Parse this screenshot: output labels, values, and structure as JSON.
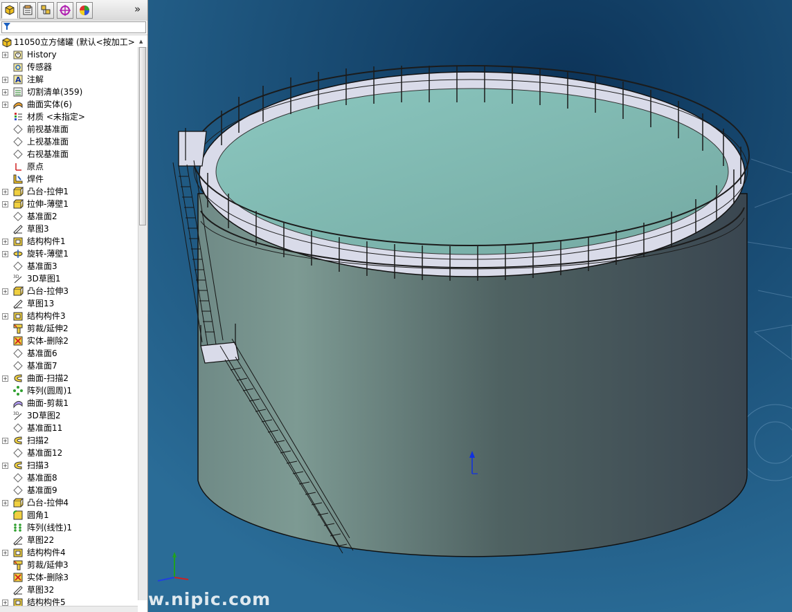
{
  "feature_manager": {
    "tabs": [
      {
        "name": "featuremanager-tab-icon"
      },
      {
        "name": "propertymanager-tab-icon"
      },
      {
        "name": "configurationmanager-tab-icon"
      },
      {
        "name": "dimxpert-tab-icon"
      },
      {
        "name": "displaymanager-tab-icon"
      }
    ],
    "more_label": "»",
    "filter_icon": "filter-icon",
    "root_label": "11050立方储罐 (默认<按加工>",
    "items": [
      {
        "label": "History",
        "icon": "history-icon",
        "expand": true
      },
      {
        "label": "传感器",
        "icon": "sensor-icon",
        "expand": false
      },
      {
        "label": "注解",
        "icon": "annotation-icon",
        "expand": true
      },
      {
        "label": "切割清单(359)",
        "icon": "cutlist-icon",
        "expand": true
      },
      {
        "label": "曲面实体(6)",
        "icon": "surface-body-icon",
        "expand": true
      },
      {
        "label": "材质 <未指定>",
        "icon": "material-icon",
        "expand": false
      },
      {
        "label": "前视基准面",
        "icon": "plane-icon",
        "expand": false
      },
      {
        "label": "上视基准面",
        "icon": "plane-icon",
        "expand": false
      },
      {
        "label": "右视基准面",
        "icon": "plane-icon",
        "expand": false
      },
      {
        "label": "原点",
        "icon": "origin-icon",
        "expand": false
      },
      {
        "label": "焊件",
        "icon": "weldment-icon",
        "expand": false
      },
      {
        "label": "凸台-拉伸1",
        "icon": "boss-extrude-icon",
        "expand": true
      },
      {
        "label": "拉伸-薄壁1",
        "icon": "boss-extrude-icon",
        "expand": true
      },
      {
        "label": "基准面2",
        "icon": "plane-icon",
        "expand": false
      },
      {
        "label": "草图3",
        "icon": "sketch-icon",
        "expand": false
      },
      {
        "label": "结构构件1",
        "icon": "structural-member-icon",
        "expand": true
      },
      {
        "label": "旋转-薄壁1",
        "icon": "revolve-icon",
        "expand": true
      },
      {
        "label": "基准面3",
        "icon": "plane-icon",
        "expand": false
      },
      {
        "label": "3D草图1",
        "icon": "sketch3d-icon",
        "expand": false
      },
      {
        "label": "凸台-拉伸3",
        "icon": "boss-extrude-icon",
        "expand": true
      },
      {
        "label": "草图13",
        "icon": "sketch-icon",
        "expand": false
      },
      {
        "label": "结构构件3",
        "icon": "structural-member-icon",
        "expand": true
      },
      {
        "label": "剪裁/延伸2",
        "icon": "trim-extend-icon",
        "expand": false
      },
      {
        "label": "实体-删除2",
        "icon": "delete-body-icon",
        "expand": false
      },
      {
        "label": "基准面6",
        "icon": "plane-icon",
        "expand": false
      },
      {
        "label": "基准面7",
        "icon": "plane-icon",
        "expand": false
      },
      {
        "label": "曲面-扫描2",
        "icon": "sweep-icon",
        "expand": true
      },
      {
        "label": "阵列(圆周)1",
        "icon": "circular-pattern-icon",
        "expand": false
      },
      {
        "label": "曲面-剪裁1",
        "icon": "surface-trim-icon",
        "expand": false
      },
      {
        "label": "3D草图2",
        "icon": "sketch3d-icon",
        "expand": false
      },
      {
        "label": "基准面11",
        "icon": "plane-icon",
        "expand": false
      },
      {
        "label": "扫描2",
        "icon": "sweep-icon",
        "expand": true
      },
      {
        "label": "基准面12",
        "icon": "plane-icon",
        "expand": false
      },
      {
        "label": "扫描3",
        "icon": "sweep-icon",
        "expand": true
      },
      {
        "label": "基准面8",
        "icon": "plane-icon",
        "expand": false
      },
      {
        "label": "基准面9",
        "icon": "plane-icon",
        "expand": false
      },
      {
        "label": "凸台-拉伸4",
        "icon": "boss-extrude-icon",
        "expand": true
      },
      {
        "label": "圆角1",
        "icon": "fillet-icon",
        "expand": false
      },
      {
        "label": "阵列(线性)1",
        "icon": "linear-pattern-icon",
        "expand": false
      },
      {
        "label": "草图22",
        "icon": "sketch-icon",
        "expand": false
      },
      {
        "label": "结构构件4",
        "icon": "structural-member-icon",
        "expand": true
      },
      {
        "label": "剪裁/延伸3",
        "icon": "trim-extend-icon",
        "expand": false
      },
      {
        "label": "实体-删除3",
        "icon": "delete-body-icon",
        "expand": false
      },
      {
        "label": "草图32",
        "icon": "sketch-icon",
        "expand": false
      },
      {
        "label": "结构构件5",
        "icon": "structural-member-icon",
        "expand": true
      }
    ]
  },
  "viewport": {
    "background_top": "#0f3d66",
    "background_bottom": "#2b6a94",
    "model_name": "11050立方储罐",
    "tank_wall_light": "#7f9d96",
    "tank_wall_dark": "#3d4a52",
    "tank_roof": "#86c1b9",
    "walkway": "#d9dbe9",
    "rail": "#1b1b1b",
    "triad_icon": "triad-icon",
    "origin_icon": "origin-arrow-icon"
  },
  "watermark": "w.nipic.com"
}
